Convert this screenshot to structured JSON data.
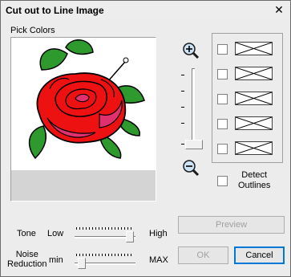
{
  "window": {
    "title": "Cut out to Line Image",
    "close_glyph": "✕"
  },
  "preview": {
    "label": "Pick Colors"
  },
  "zoom": {
    "in_icon": "zoom-in-icon",
    "out_icon": "zoom-out-icon"
  },
  "colors": {
    "detect_outlines": "Detect\nOutlines"
  },
  "tone": {
    "label": "Tone",
    "low": "Low",
    "high": "High",
    "level": 0.97
  },
  "noise": {
    "label": "Noise\nReduction",
    "min": "min",
    "max": "MAX",
    "level": 0.06
  },
  "buttons": {
    "preview": "Preview",
    "ok": "OK",
    "cancel": "Cancel"
  },
  "accent": "#0078d7"
}
